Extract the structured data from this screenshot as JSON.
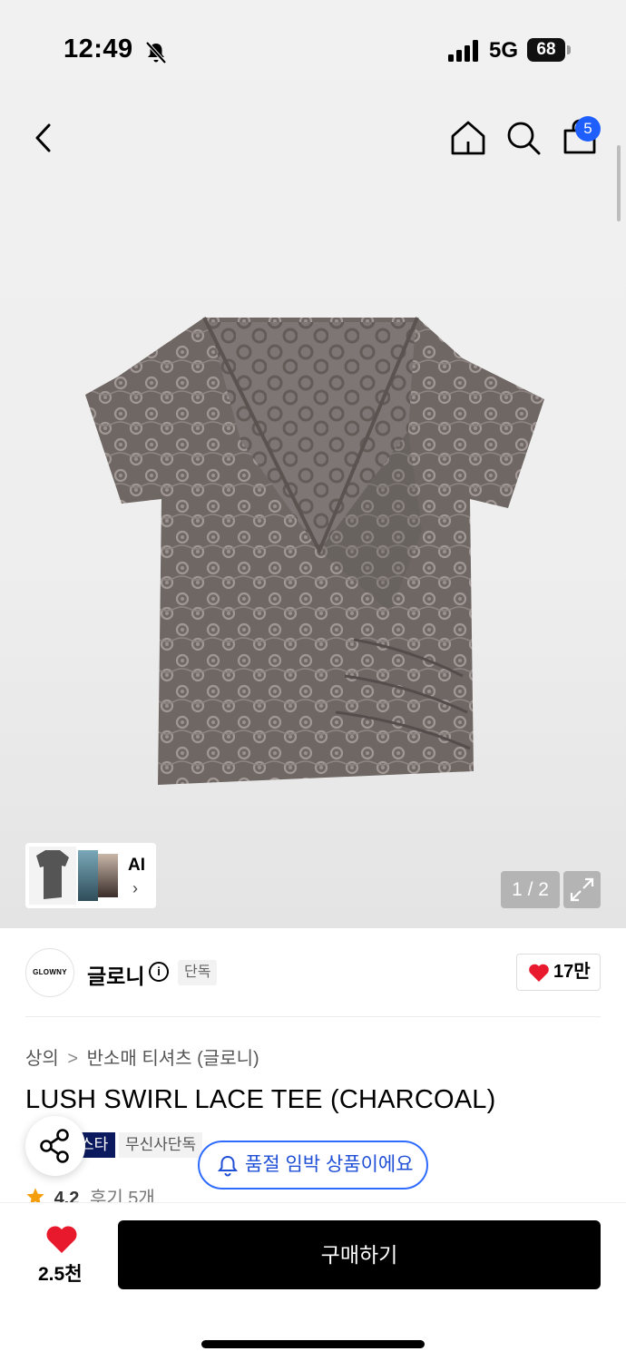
{
  "status_bar": {
    "time": "12:49",
    "network": "5G",
    "battery": "68"
  },
  "header": {
    "cart_count": "5"
  },
  "gallery": {
    "thumb_label": "AI",
    "counter": "1 / 2"
  },
  "brand": {
    "logo_text": "GLOWNY",
    "name": "글로니",
    "tag": "단독",
    "likes": "17만"
  },
  "breadcrumb": {
    "level1": "상의",
    "separator": ">",
    "level2": "반소매 티셔츠 (글로니)"
  },
  "product": {
    "title": "LUSH SWIRL LACE TEE (CHARCOAL)",
    "tags": [
      "스타",
      "무신사단독"
    ],
    "soldout_notice": "품절 임박 상품이에요",
    "rating": "4.2",
    "review_text": "후기 5개"
  },
  "bottom_bar": {
    "like_count": "2.5천",
    "buy_label": "구매하기"
  },
  "colors": {
    "accent_blue": "#2f6bff",
    "badge_blue": "#1f5fff",
    "heart_red": "#e8192c",
    "star_orange": "#f59e0b",
    "tag_navy": "#0b1a5e"
  },
  "icons": [
    "back-icon",
    "home-icon",
    "search-icon",
    "cart-icon",
    "expand-icon",
    "info-icon",
    "heart-icon",
    "share-icon",
    "bell-icon",
    "star-icon"
  ]
}
